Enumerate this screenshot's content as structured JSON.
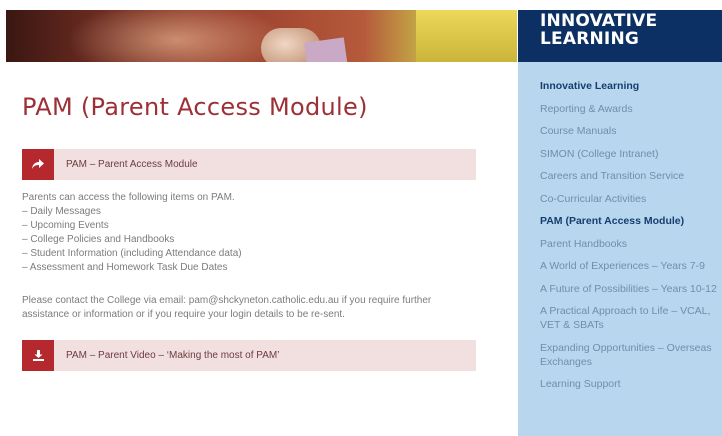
{
  "sidebar": {
    "heading_line1": "INNOVATIVE",
    "heading_line2": "LEARNING",
    "items": [
      {
        "label": "Innovative Learning",
        "active": true
      },
      {
        "label": "Reporting & Awards",
        "active": false
      },
      {
        "label": "Course Manuals",
        "active": false
      },
      {
        "label": "SIMON (College Intranet)",
        "active": false
      },
      {
        "label": "Careers and Transition Service",
        "active": false
      },
      {
        "label": "Co-Curricular Activities",
        "active": false
      },
      {
        "label": "PAM (Parent Access Module)",
        "active": true
      },
      {
        "label": "Parent Handbooks",
        "active": false
      },
      {
        "label": "A World of Experiences – Years 7-9",
        "active": false
      },
      {
        "label": "A Future of Possibilities – Years 10-12",
        "active": false
      },
      {
        "label": "A Practical Approach to Life – VCAL, VET & SBATs",
        "active": false
      },
      {
        "label": "Expanding Opportunities – Overseas Exchanges",
        "active": false
      },
      {
        "label": "Learning Support",
        "active": false
      }
    ]
  },
  "main": {
    "title": "PAM (Parent Access Module)",
    "link1": {
      "icon": "share-arrow-icon",
      "label": "PAM – Parent Access Module"
    },
    "intro": "Parents can access the following items on PAM.",
    "list": [
      "– Daily Messages",
      "– Upcoming Events",
      "– College Policies and Handbooks",
      "– Student Information (including Attendance data)",
      "– Assessment and Homework Task Due Dates"
    ],
    "contact_line1": "Please contact the College via email: pam@shckyneton.catholic.edu.au if you require further",
    "contact_line2": "assistance or information or if you require your login details to be re-sent.",
    "link2": {
      "icon": "download-icon",
      "label": "PAM – Parent Video – ‘Making the most of PAM’"
    }
  },
  "colors": {
    "accent_red": "#b5282e",
    "title_red": "#9d3036",
    "navy": "#0c2f64",
    "sidebar_blue": "#b8d6ee"
  }
}
